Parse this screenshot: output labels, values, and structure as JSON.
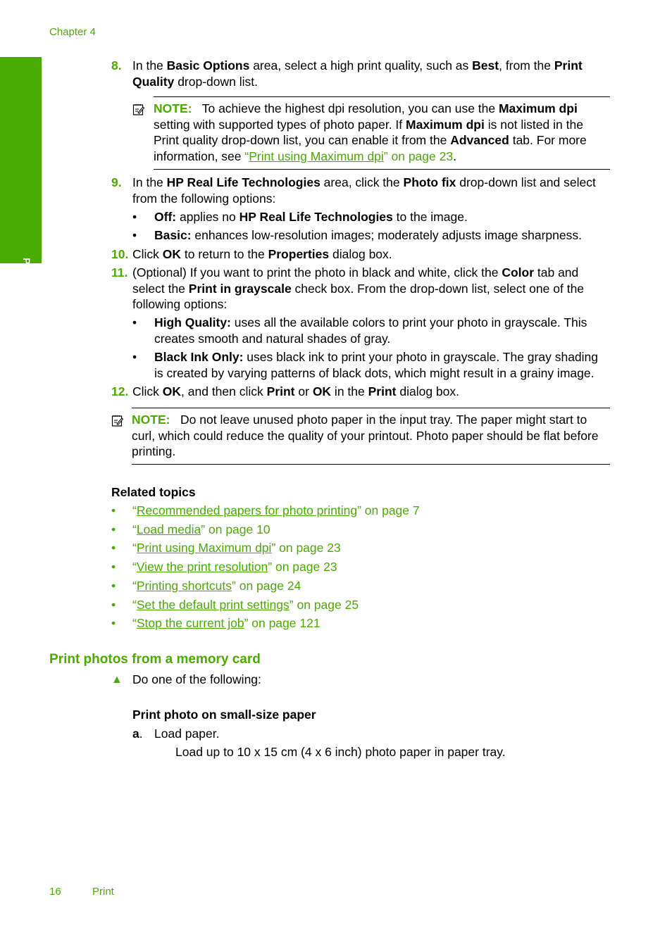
{
  "header": {
    "chapter": "Chapter 4"
  },
  "sidetab": {
    "label": "Print",
    "color": "#4aab00"
  },
  "steps": {
    "s8": {
      "num": "8.",
      "t1": "In the ",
      "b1": "Basic Options",
      "t2": " area, select a high print quality, such as ",
      "b2": "Best",
      "t3": ", from the ",
      "b3": "Print",
      "b4": "Quality",
      "t4": " drop-down list."
    },
    "note1": {
      "label": "NOTE:",
      "t1": "To achieve the highest dpi resolution, you can use the ",
      "b1": "Maximum dpi",
      "l2": "setting with supported types of photo paper. If ",
      "b2": "Maximum dpi",
      "t2b": " is not listed in the",
      "l3": "Print quality drop-down list, you can enable it from the ",
      "b3": "Advanced",
      "t3b": " tab. For more",
      "l4": "information, see ",
      "link_open": "“",
      "link": "Print using Maximum dpi",
      "link_tail": "” on page 23",
      "end": "."
    },
    "s9": {
      "num": "9.",
      "t1": "In the ",
      "b1": "HP Real Life Technologies",
      "t2": " area, click the ",
      "b2": "Photo fix",
      "t3": " drop-down list and select",
      "l2": "from the following options:"
    },
    "s9_opts": [
      {
        "bullet": "•",
        "b": "Off:",
        "t": " applies no ",
        "b2": "HP Real Life Technologies",
        "t2": " to the image."
      },
      {
        "bullet": "•",
        "b": "Basic:",
        "t": " enhances low-resolution images; moderately adjusts image sharpness."
      }
    ],
    "s10": {
      "num": "10.",
      "t1": "Click ",
      "b1": "OK",
      "t2": " to return to the ",
      "b2": "Properties",
      "t3": " dialog box."
    },
    "s11": {
      "num": "11.",
      "t1": "(Optional) If you want to print the photo in black and white, click the ",
      "b1": "Color",
      "t2": " tab and",
      "l2a": "select the ",
      "b2": "Print in grayscale",
      "l2b": " check box. From the drop-down list, select one of the",
      "l3": "following options:"
    },
    "s11_opts": [
      {
        "bullet": "•",
        "b": "High Quality:",
        "t": " uses all the available colors to print your photo in grayscale. This",
        "l2": "creates smooth and natural shades of gray."
      },
      {
        "bullet": "•",
        "b": "Black Ink Only:",
        "t": " uses black ink to print your photo in grayscale. The gray shading",
        "l2": "is created by varying patterns of black dots, which might result in a grainy image."
      }
    ],
    "s12": {
      "num": "12.",
      "t1": "Click ",
      "b1": "OK",
      "t2": ", and then click ",
      "b2": "Print",
      "t3": " or ",
      "b3": "OK",
      "t4": " in the ",
      "b4": "Print",
      "t5": " dialog box."
    },
    "note2": {
      "label": "NOTE:",
      "l1": "Do not leave unused photo paper in the input tray. The paper might start to",
      "l2": "curl, which could reduce the quality of your printout. Photo paper should be flat before",
      "l3": "printing."
    }
  },
  "related": {
    "heading": "Related topics",
    "items": [
      {
        "bullet": "•",
        "open": "“",
        "link": "Recommended papers for photo printing",
        "tail": "” on page 7"
      },
      {
        "bullet": "•",
        "open": "“",
        "link": "Load media",
        "tail": "” on page 10"
      },
      {
        "bullet": "•",
        "open": "“",
        "link": "Print using Maximum dpi",
        "tail": "” on page 23"
      },
      {
        "bullet": "•",
        "open": "“",
        "link": "View the print resolution",
        "tail": "” on page 23"
      },
      {
        "bullet": "•",
        "open": "“",
        "link": "Printing shortcuts",
        "tail": "” on page 24"
      },
      {
        "bullet": "•",
        "open": "“",
        "link": "Set the default print settings",
        "tail": "” on page 25"
      },
      {
        "bullet": "•",
        "open": "“",
        "link": "Stop the current job",
        "tail": "” on page 121"
      }
    ]
  },
  "section": {
    "title": "Print photos from a memory card",
    "triangle": "▲",
    "intro": "Do one of the following:",
    "subheading": "Print photo on small-size paper",
    "step_a_label": "a",
    "step_a_dot": ".",
    "step_a": "Load paper.",
    "step_a_detail": "Load up to 10 x 15 cm (4 x 6 inch) photo paper in paper tray."
  },
  "footer": {
    "page": "16",
    "section": "Print"
  }
}
